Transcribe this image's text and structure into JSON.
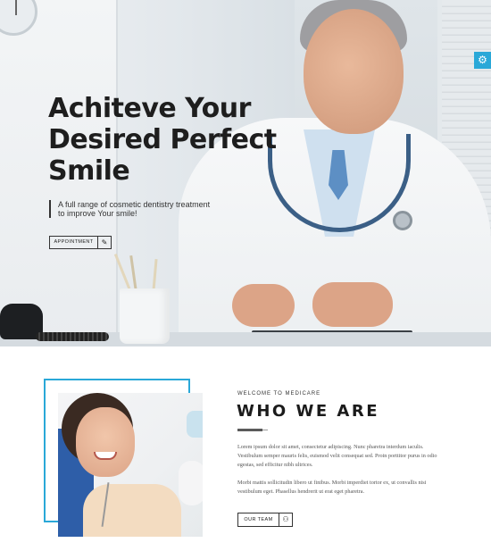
{
  "hero": {
    "title_line1": "Achiteve Your",
    "title_line2": "Desired Perfect",
    "title_line3": "Smile",
    "subtitle_line1": "A full range of cosmetic dentistry treatment",
    "subtitle_line2": "to improve Your smile!",
    "appointment_label": "APPOINTMENT",
    "appointment_icon": "pencil-icon"
  },
  "settings": {
    "icon": "gear-icon"
  },
  "about": {
    "eyebrow": "WELCOME TO MEDICARE",
    "title": "WHO WE ARE",
    "paragraph1": "Lorem ipsum dolor sit amet, consectetur adipiscing. Nunc pharetra interdum iaculis. Vestibulum semper mauris felis, euismod velit consequat sed. Proin porttitor purus in odio egestas, sed efficitur nibh ultrices.",
    "paragraph2": "Morbi mattis sollicitudin libero ut finibus. Morbi imperdiet tortor ex, ut convallis nisi vestibulum eget. Phasellus hendrerit ut erat eget pharetra.",
    "team_label": "OUR TEAM",
    "team_icon": "team-icon"
  },
  "colors": {
    "accent": "#2aa8d8",
    "heading": "#1e1e1e"
  }
}
